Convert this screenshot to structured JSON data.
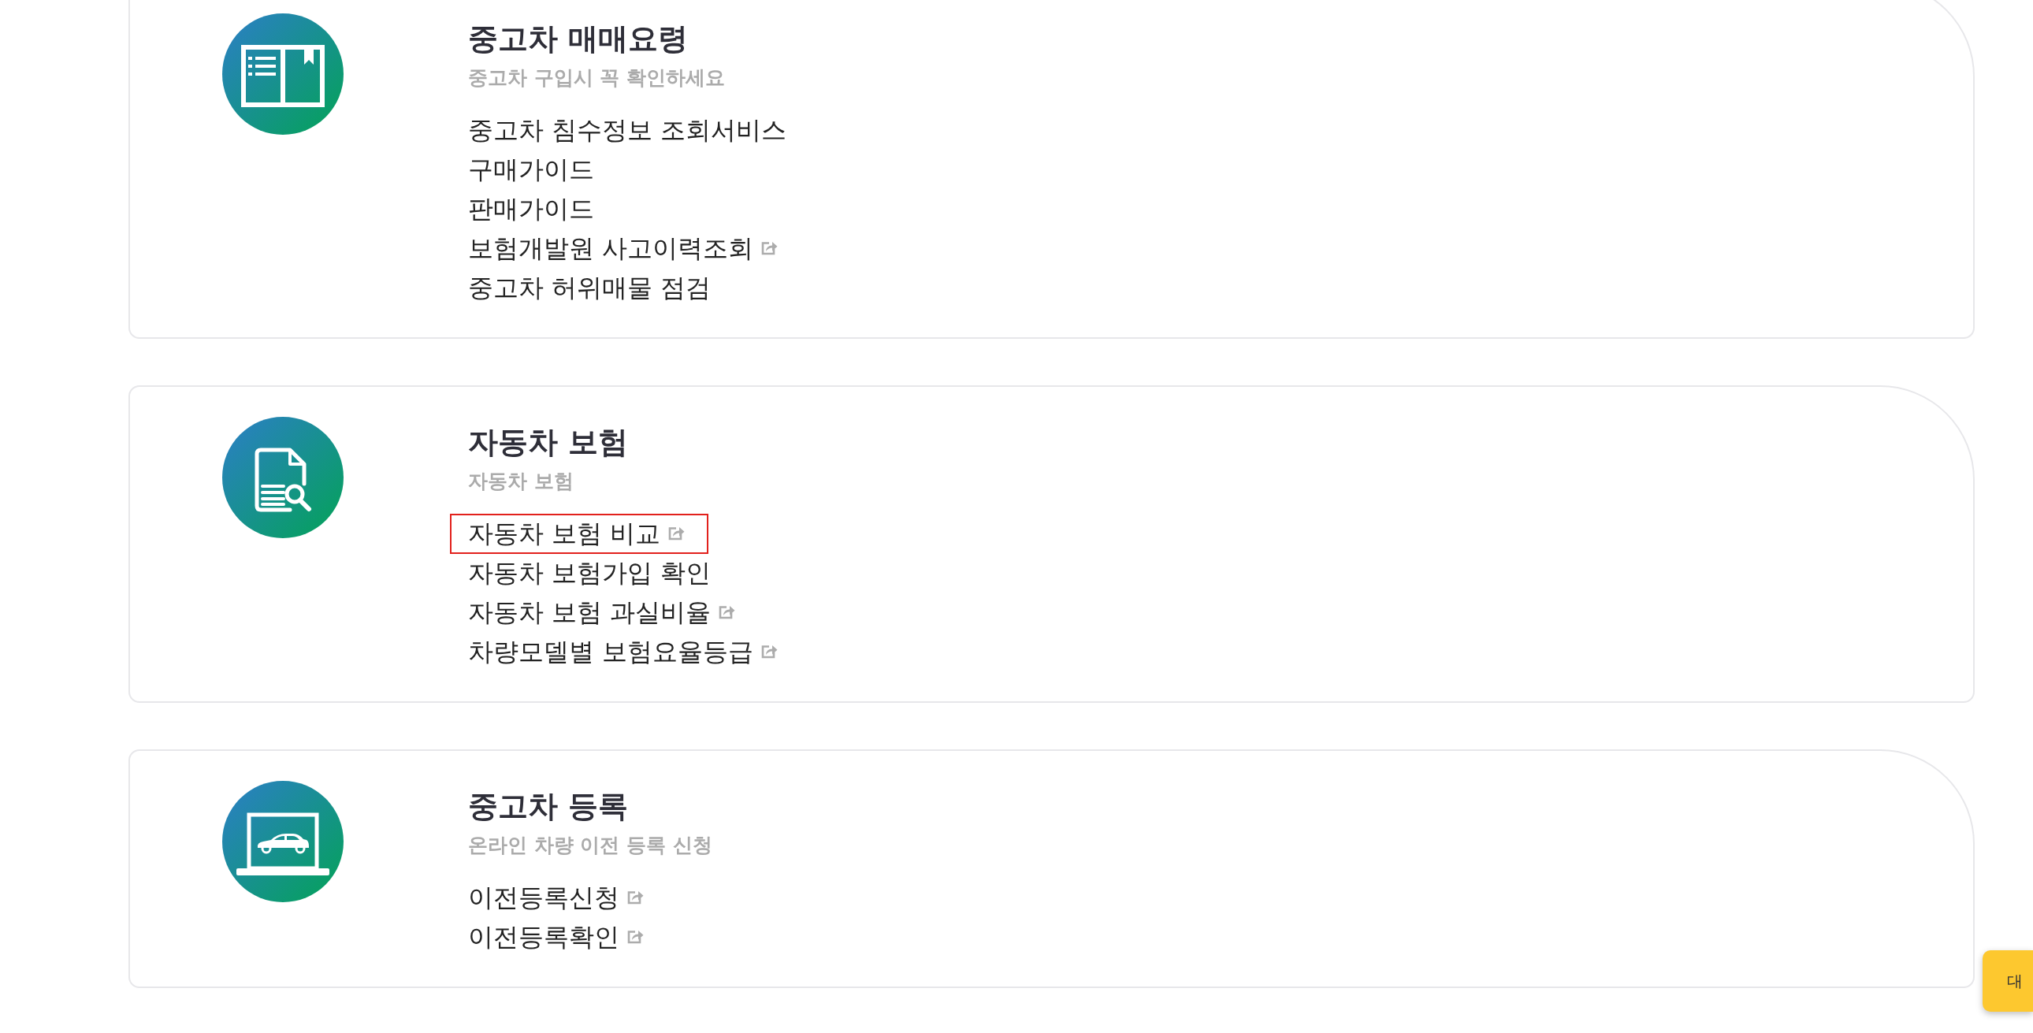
{
  "sections": [
    {
      "title": "중고차 매매요령",
      "subtitle": "중고차 구입시 꼭 확인하세요",
      "links": [
        {
          "label": "중고차 침수정보 조회서비스",
          "external": false,
          "highlighted": false
        },
        {
          "label": "구매가이드",
          "external": false,
          "highlighted": false
        },
        {
          "label": "판매가이드",
          "external": false,
          "highlighted": false
        },
        {
          "label": "보험개발원 사고이력조회",
          "external": true,
          "highlighted": false
        },
        {
          "label": "중고차 허위매물 점검",
          "external": false,
          "highlighted": false
        }
      ]
    },
    {
      "title": "자동차 보험",
      "subtitle": "자동차 보험",
      "links": [
        {
          "label": "자동차 보험 비교",
          "external": true,
          "highlighted": true
        },
        {
          "label": "자동차 보험가입 확인",
          "external": false,
          "highlighted": false
        },
        {
          "label": "자동차 보험 과실비율",
          "external": true,
          "highlighted": false
        },
        {
          "label": "차량모델별 보험요율등급",
          "external": true,
          "highlighted": false
        }
      ]
    },
    {
      "title": "중고차 등록",
      "subtitle": "온라인 차량 이전 등록 신청",
      "links": [
        {
          "label": "이전등록신청",
          "external": true,
          "highlighted": false
        },
        {
          "label": "이전등록확인",
          "external": true,
          "highlighted": false
        }
      ]
    }
  ],
  "chat_button": {
    "label": "대"
  }
}
